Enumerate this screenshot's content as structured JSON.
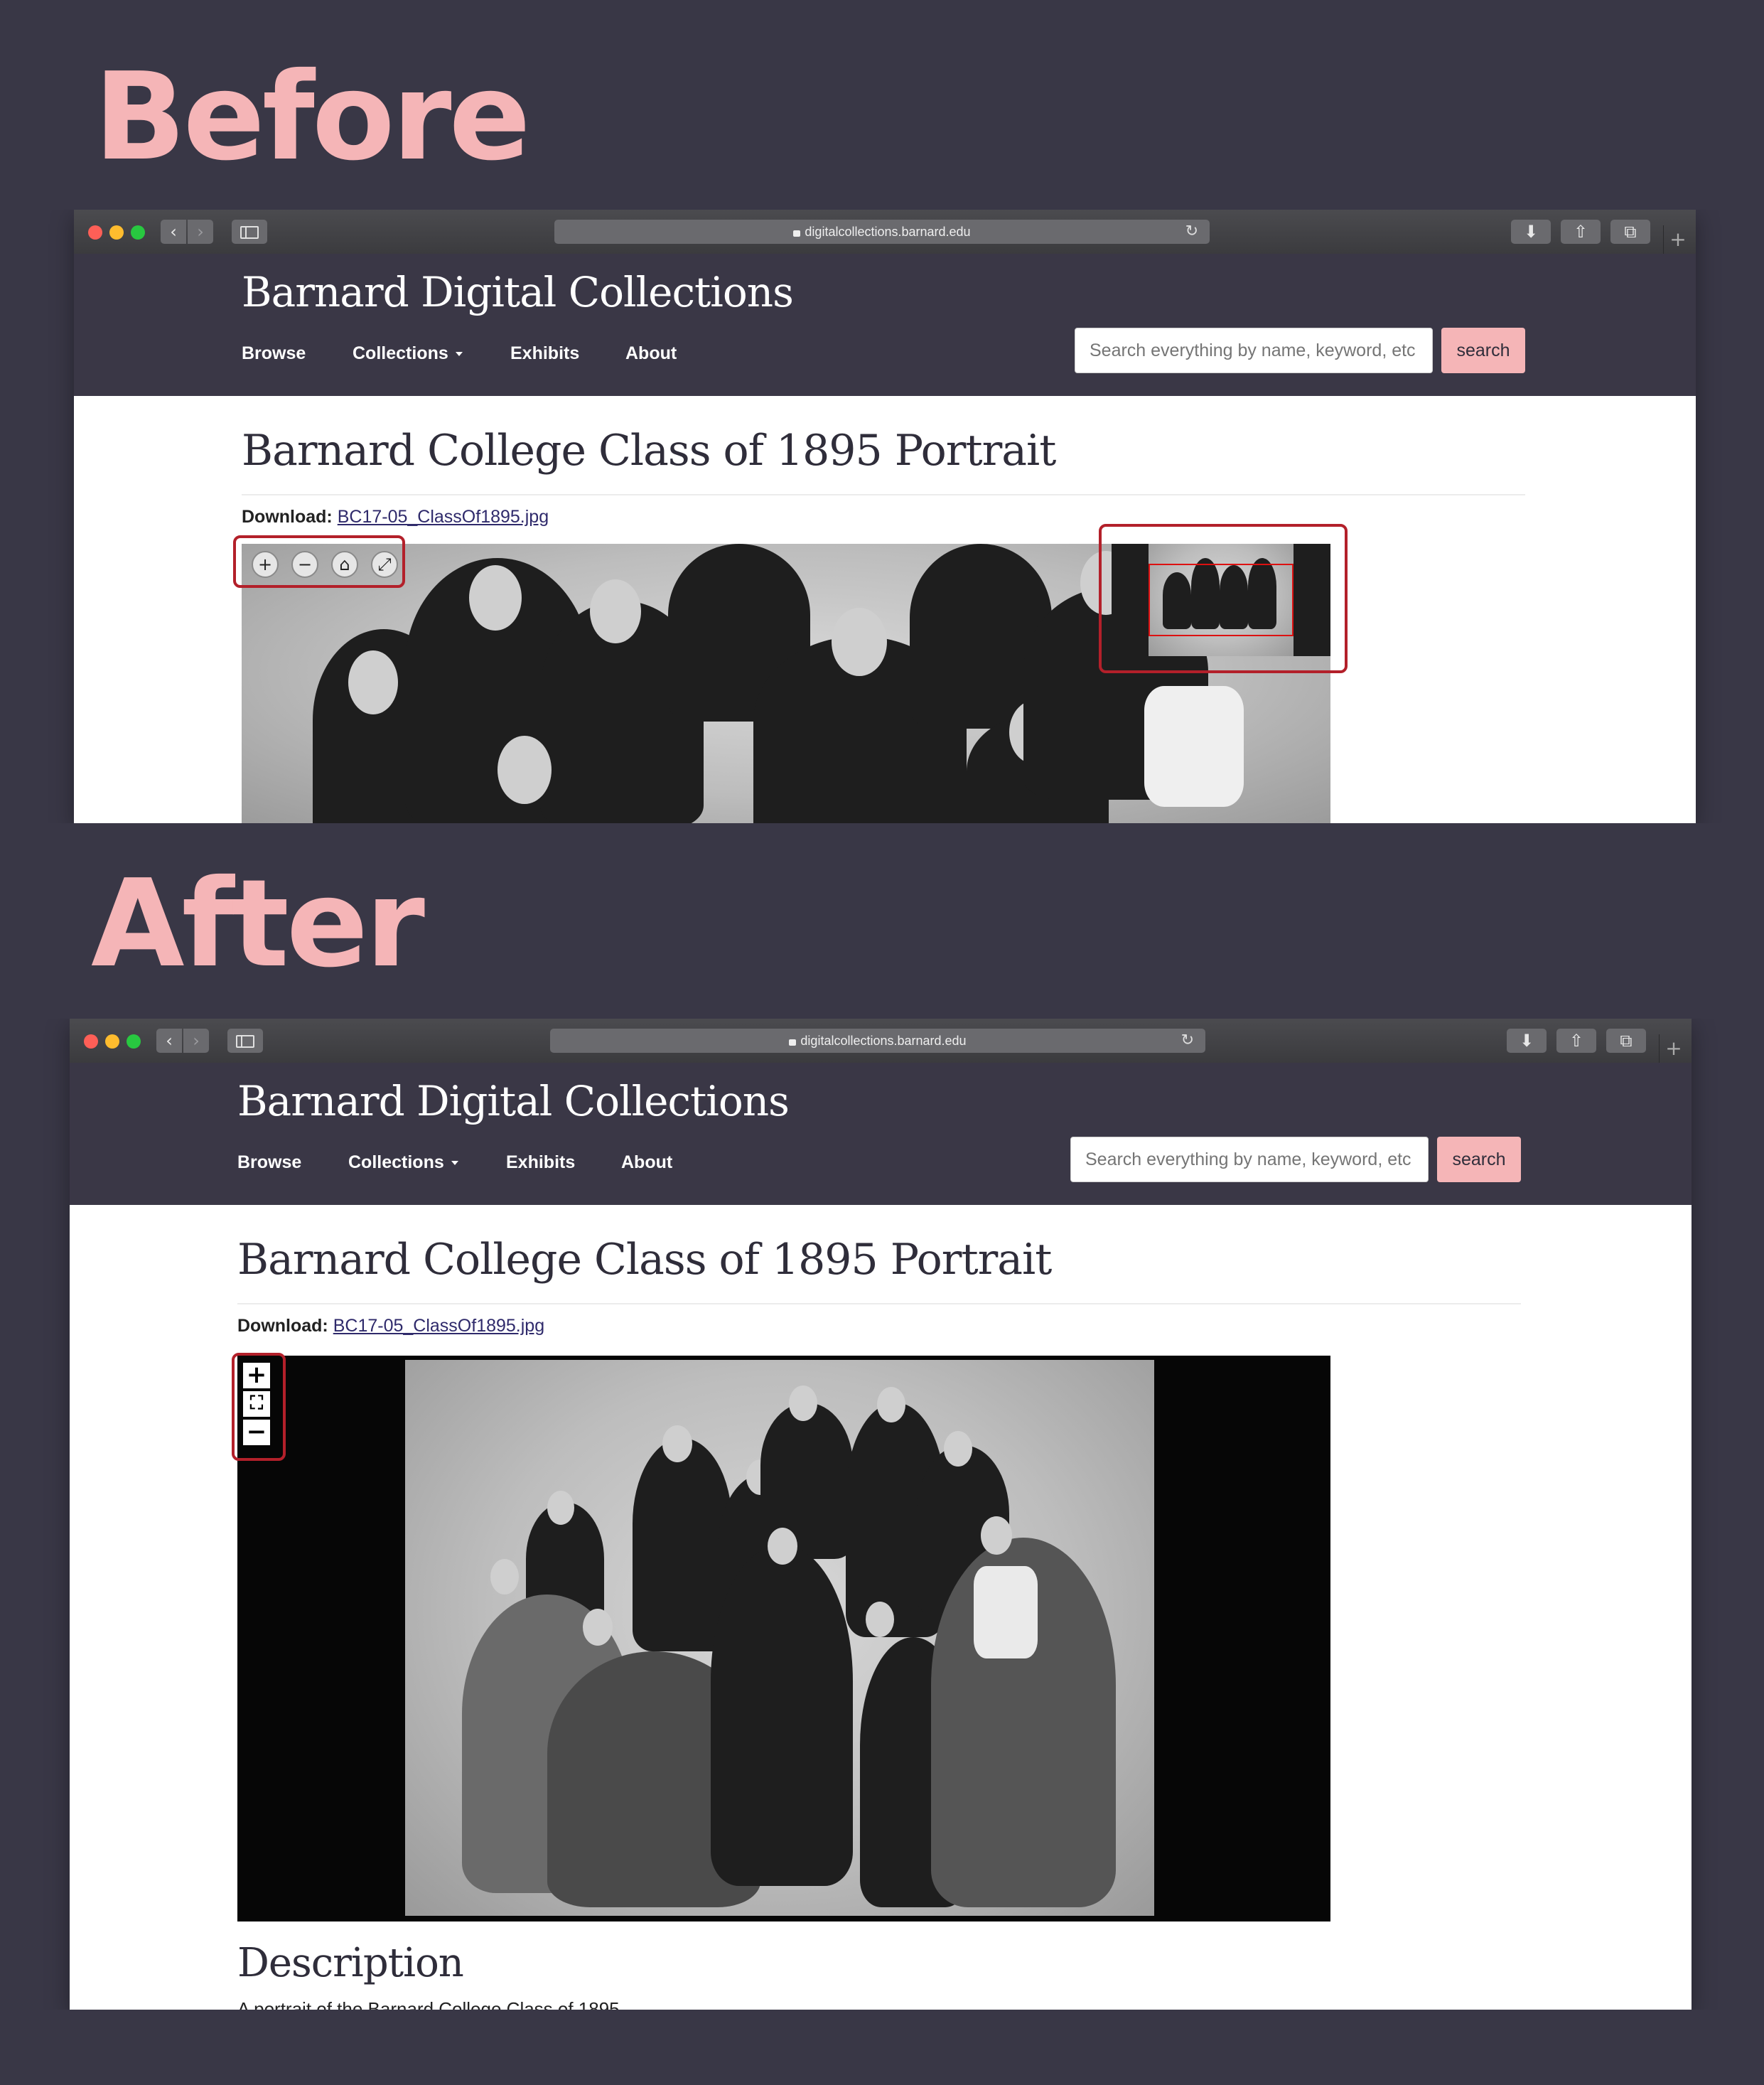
{
  "before_label": "Before",
  "after_label": "After",
  "browser": {
    "url": "digitalcollections.barnard.edu",
    "back_glyph": "‹",
    "forward_glyph": "›",
    "reload_glyph": "↻",
    "download_glyph": "⬇",
    "share_glyph": "⇧",
    "tabs_glyph": "⧉",
    "new_tab_glyph": "+"
  },
  "site": {
    "title": "Barnard Digital Collections",
    "nav": [
      "Browse",
      "Collections",
      "Exhibits",
      "About"
    ],
    "search_placeholder": "Search everything by name, keyword, etc",
    "search_button": "search"
  },
  "item": {
    "title": "Barnard College Class of 1895 Portrait",
    "download_label": "Download:",
    "download_file": "BC17-05_ClassOf1895.jpg",
    "description_heading": "Description",
    "description_text": "A portrait of the Barnard College Class of 1895"
  },
  "before_controls": [
    "+",
    "−",
    "⌂",
    "⤢"
  ],
  "after_controls": [
    "+",
    "⛶",
    "−"
  ],
  "colors": {
    "background": "#393746",
    "accent": "#f5b5b7",
    "header": "#3a3746",
    "highlight": "#b3202a"
  }
}
